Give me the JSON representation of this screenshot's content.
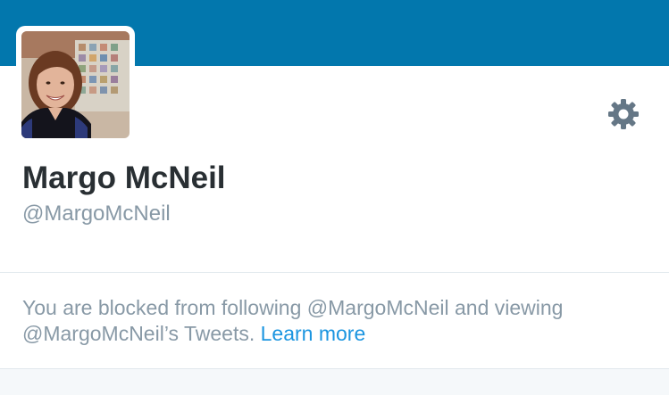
{
  "profile": {
    "name": "Margo McNeil",
    "handle": "@MargoMcNeil",
    "avatar_alt": "Profile photo"
  },
  "blocked": {
    "line1": "You are blocked from following @MargoMcNeil and viewing",
    "line2_prefix": "@MargoMcNeil’s Tweets.",
    "learn_more": "Learn more"
  },
  "icons": {
    "settings": "gear-icon"
  },
  "colors": {
    "banner": "#0277ad",
    "name_text": "#292f33",
    "muted_text": "#8899a6",
    "link": "#1b95e0",
    "gear": "#657786",
    "divider": "#e1e8ed",
    "footer_bg": "#f5f8fa"
  }
}
